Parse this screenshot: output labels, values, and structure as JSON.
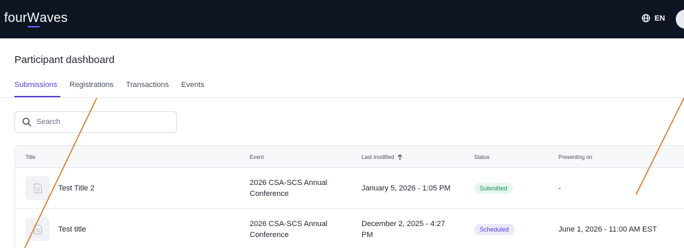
{
  "header": {
    "logo_prefix": "four",
    "logo_w": "W",
    "logo_suffix": "aves",
    "language": "EN"
  },
  "page": {
    "title": "Participant dashboard"
  },
  "tabs": [
    {
      "label": "Submissions",
      "active": true
    },
    {
      "label": "Registrations",
      "active": false
    },
    {
      "label": "Transactions",
      "active": false
    },
    {
      "label": "Events",
      "active": false
    }
  ],
  "search": {
    "placeholder": "Search"
  },
  "table": {
    "columns": {
      "title": "Title",
      "event": "Event",
      "last_modified": "Last modified",
      "status": "Status",
      "presenting_on": "Presenting on"
    },
    "rows": [
      {
        "title": "Test Title 2",
        "event_line1": "2026 CSA-SCS Annual",
        "event_line2": "Conference",
        "modified_line1": "January 5, 2026 - 1:05 PM",
        "modified_line2": "",
        "status": "Submitted",
        "presenting_on": "-"
      },
      {
        "title": "Test title",
        "event_line1": "2026 CSA-SCS Annual",
        "event_line2": "Conference",
        "modified_line1": "December 2, 2025 - 4:27",
        "modified_line2": "PM",
        "status": "Scheduled",
        "presenting_on": "June 1, 2026 - 11:00 AM EST"
      }
    ]
  },
  "colors": {
    "topbar": "#0d1422",
    "accent": "#5b3fd3",
    "annotation": "#e0782a"
  }
}
